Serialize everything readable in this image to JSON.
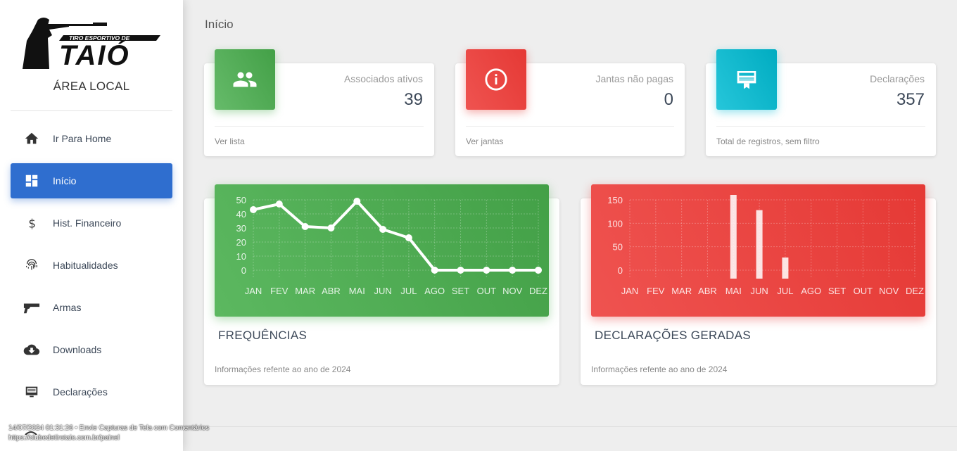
{
  "sidebar": {
    "logo_text": "TIRO ESPORTIVO DE",
    "logo_big": "TAIÓ",
    "title": "ÁREA LOCAL",
    "items": [
      {
        "label": "Ir Para Home",
        "icon": "home-icon"
      },
      {
        "label": "Início",
        "icon": "dashboard-icon",
        "active": true
      },
      {
        "label": "Hist. Financeiro",
        "icon": "dollar-icon"
      },
      {
        "label": "Habitualidades",
        "icon": "fingerprint-icon"
      },
      {
        "label": "Armas",
        "icon": "pistol-icon"
      },
      {
        "label": "Downloads",
        "icon": "cloud-download-icon"
      },
      {
        "label": "Declarações",
        "icon": "card-icon"
      }
    ]
  },
  "header": {
    "breadcrumb": "Início"
  },
  "stats": [
    {
      "category": "Associados ativos",
      "value": "39",
      "footer": "Ver lista",
      "color": "#4caf50",
      "icon": "people-icon"
    },
    {
      "category": "Jantas não pagas",
      "value": "0",
      "footer": "Ver jantas",
      "color": "#e53935",
      "icon": "info-icon"
    },
    {
      "category": "Declarações",
      "value": "357",
      "footer": "Total de registros, sem filtro",
      "color": "#00bcd4",
      "icon": "certificate-icon"
    }
  ],
  "charts": [
    {
      "title": "FREQUÊNCIAS",
      "footer": "Informações refente ao ano de 2024",
      "color": "#4caf50"
    },
    {
      "title": "DECLARAÇÕES GERADAS",
      "footer": "Informações refente ao ano de 2024",
      "color": "#e53935"
    }
  ],
  "chart_data": [
    {
      "type": "line",
      "title": "FREQUÊNCIAS",
      "categories": [
        "JAN",
        "FEV",
        "MAR",
        "ABR",
        "MAI",
        "JUN",
        "JUL",
        "AGO",
        "SET",
        "OUT",
        "NOV",
        "DEZ"
      ],
      "values": [
        43,
        47,
        31,
        30,
        49,
        29,
        23,
        0,
        0,
        0,
        0,
        0
      ],
      "ylim": [
        0,
        50
      ],
      "yticks": [
        0,
        10,
        20,
        30,
        40,
        50
      ],
      "grid": true
    },
    {
      "type": "bar",
      "title": "DECLARAÇÕES GERADAS",
      "categories": [
        "JAN",
        "FEV",
        "MAR",
        "ABR",
        "MAI",
        "JUN",
        "JUL",
        "AGO",
        "SET",
        "OUT",
        "NOV",
        "DEZ"
      ],
      "values": [
        0,
        0,
        0,
        0,
        199,
        128,
        27,
        0,
        0,
        0,
        0,
        0
      ],
      "ylim": [
        0,
        150
      ],
      "yticks": [
        0,
        50,
        100,
        150
      ],
      "grid": true
    }
  ],
  "overlay": {
    "line1": "14/07/2024 01:31:26 • Envie Capturas de Tela com Comentários",
    "line2": "https://clubedetirotaio.com.br/painel"
  }
}
